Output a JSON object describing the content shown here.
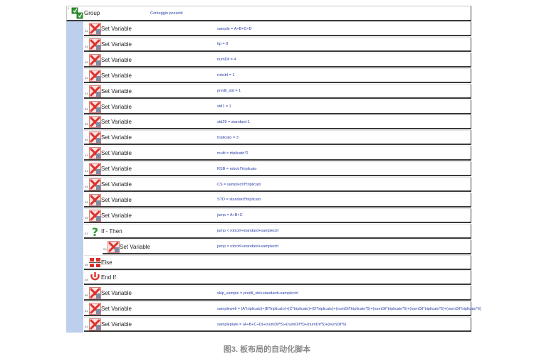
{
  "group": {
    "number": "1",
    "label": "Group",
    "description": "Conteggio pozzetti"
  },
  "rows": [
    {
      "number": "26",
      "type": "set",
      "label": "Set Variable",
      "expr": "sample = A+B+C+D"
    },
    {
      "number": "28",
      "type": "set",
      "label": "Set Variable",
      "expr": "tip = 8"
    },
    {
      "number": "30",
      "type": "set",
      "label": "Set Variable",
      "expr": "numDil = 4"
    },
    {
      "number": "32",
      "type": "set",
      "label": "Set Variable",
      "expr": "robctrl = 1"
    },
    {
      "number": "34",
      "type": "set",
      "label": "Set Variable",
      "expr": "predil_std = 1"
    },
    {
      "number": "36",
      "type": "set",
      "label": "Set Variable",
      "expr": "std1 = 1"
    },
    {
      "number": "38",
      "type": "set",
      "label": "Set Variable",
      "expr": "std29 = standard-1"
    },
    {
      "number": "40",
      "type": "set",
      "label": "Set Variable",
      "expr": "triplicato = 3"
    },
    {
      "number": "42",
      "type": "set",
      "label": "Set Variable",
      "expr": "multi = triplicato*2"
    },
    {
      "number": "44",
      "type": "set",
      "label": "Set Variable",
      "expr": "RSB = robctrl*triplicato"
    },
    {
      "number": "46",
      "type": "set",
      "label": "Set Variable",
      "expr": "CS = samplectrl*triplicato"
    },
    {
      "number": "48",
      "type": "set",
      "label": "Set Variable",
      "expr": "STD = standard*triplicato"
    },
    {
      "number": "50",
      "type": "set",
      "label": "Set Variable",
      "expr": "jump = A+B+C"
    },
    {
      "number": "52",
      "type": "if",
      "label": "If - Then",
      "expr": "jump < robctrl+standard+samplectrl"
    },
    {
      "number": "54",
      "type": "set",
      "label": "Set Variable",
      "expr": "jump = robctrl+standard+samplectrl"
    },
    {
      "number": "56",
      "type": "else",
      "label": "Else",
      "expr": ""
    },
    {
      "number": "58",
      "type": "endif",
      "label": "End If",
      "expr": ""
    },
    {
      "number": "60",
      "type": "set",
      "label": "Set Variable",
      "expr": "skip_sample = predil_std+standard+samplectrl"
    },
    {
      "number": "62",
      "type": "set",
      "label": "Set Variable",
      "expr": "samplewell = (A*triplicato)+(B*triplicato)+(C*triplicato)+(D*triplicato)+(numDil*triplicato*5)+(numDil*triplicato*5)+(numDil*triplicato*5)+(numDil*triplicato*6)"
    },
    {
      "number": "64",
      "type": "set",
      "label": "Set Variable",
      "expr": "sampleplate = (A+B+C+D)+(numDil*5)+(numDil*5)+(numDil*5)+(numDil*6)"
    }
  ],
  "caption": "图3. 板布局的自动化脚本",
  "colors": {
    "left_bar": "#bcd0ee",
    "expr_text": "#2c3fa8",
    "x_icon": "#e0302a",
    "q_icon": "#2f9a2f"
  }
}
